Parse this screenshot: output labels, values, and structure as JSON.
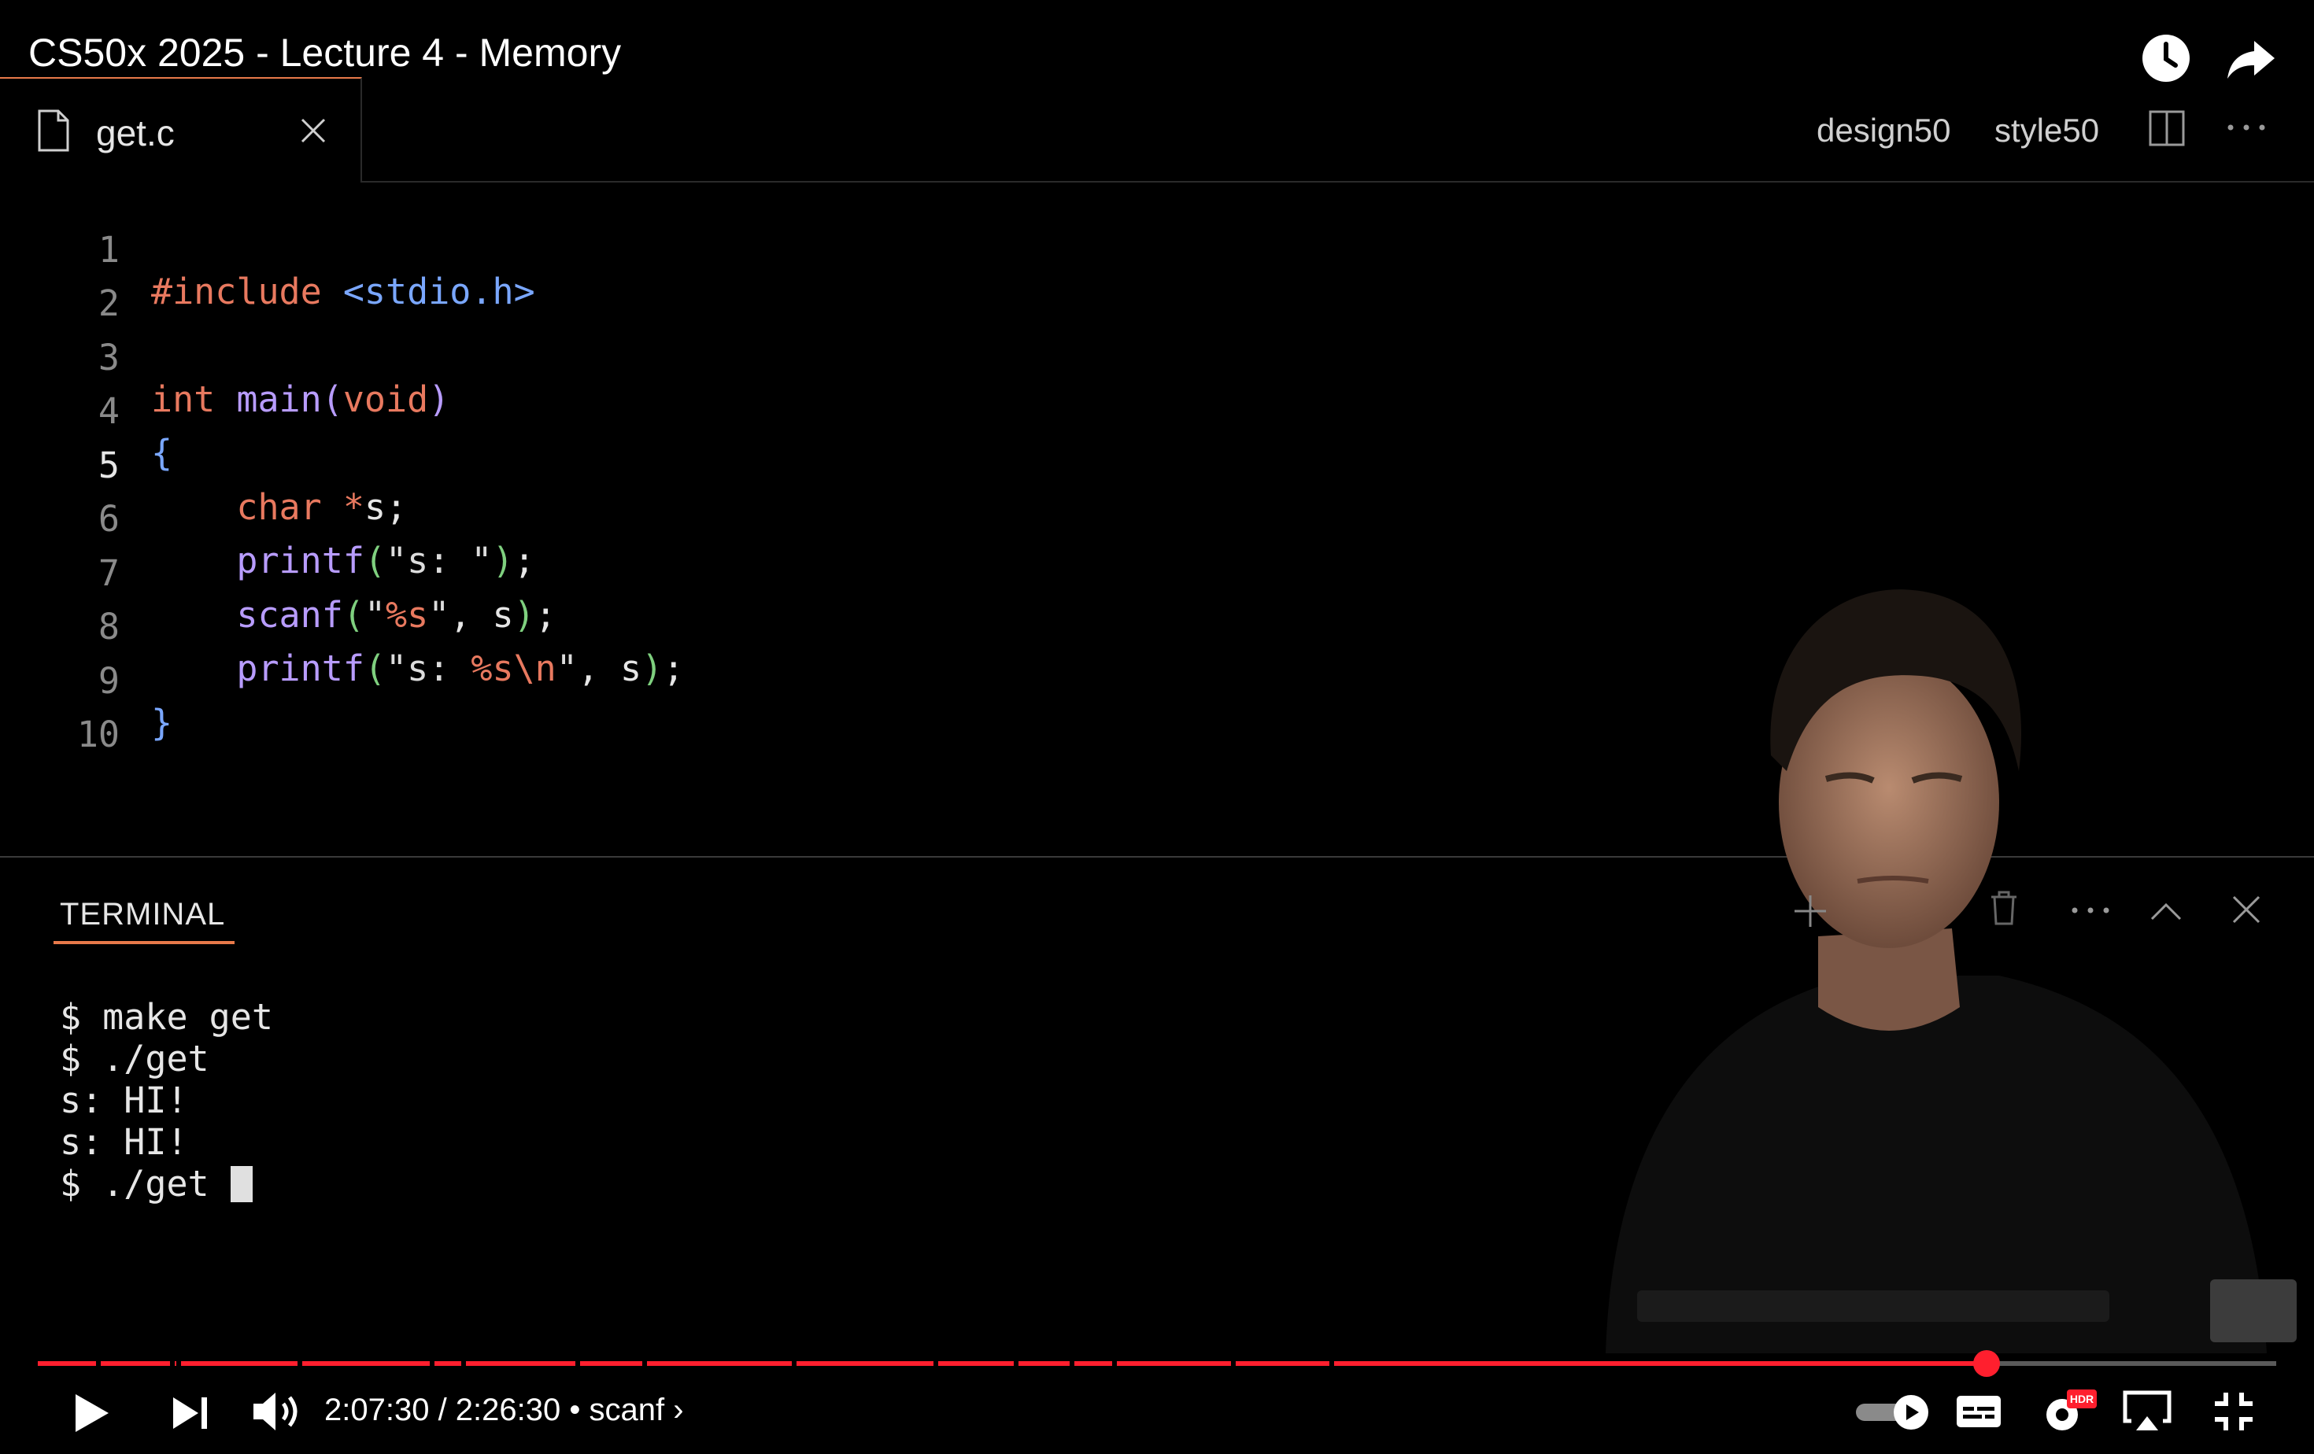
{
  "video": {
    "title": "CS50x 2025 - Lecture 4 - Memory"
  },
  "editor": {
    "tab": {
      "filename": "get.c"
    },
    "toolbar": {
      "design50": "design50",
      "style50": "style50"
    },
    "active_line": 5,
    "lines": [
      {
        "n": "1"
      },
      {
        "n": "2"
      },
      {
        "n": "3"
      },
      {
        "n": "4"
      },
      {
        "n": "5"
      },
      {
        "n": "6"
      },
      {
        "n": "7"
      },
      {
        "n": "8"
      },
      {
        "n": "9"
      },
      {
        "n": "10"
      }
    ],
    "code": {
      "l1_directive": "#include",
      "l1_header": "<stdio.h>",
      "l3_type": "int",
      "l3_name": "main",
      "l3_paren_open": "(",
      "l3_void": "void",
      "l3_paren_close": ")",
      "l4_brace": "{",
      "l5_type": "char",
      "l5_star": "*",
      "l5_rest": "s;",
      "l6_fn": "printf",
      "l6_open": "(",
      "l6_str": "\"s: \"",
      "l6_close": ")",
      "l6_semi": ";",
      "l7_fn": "scanf",
      "l7_open": "(",
      "l7_q1": "\"",
      "l7_fmt": "%s",
      "l7_q2": "\"",
      "l7_args": ", s",
      "l7_close": ")",
      "l7_semi": ";",
      "l8_fn": "printf",
      "l8_open": "(",
      "l8_q1": "\"s: ",
      "l8_fmt": "%s\\n",
      "l8_q2": "\"",
      "l8_args": ", s",
      "l8_close": ")",
      "l8_semi": ";",
      "l9_brace": "}"
    }
  },
  "terminal": {
    "tab_label": "TERMINAL",
    "lines": [
      "$ make get",
      "$ ./get",
      "s: HI!",
      "s: HI!",
      "$ ./get "
    ]
  },
  "player": {
    "time": "2:07:30 / 2:26:30",
    "chapter": "• scanf ›",
    "progress_fraction": 0.8706,
    "settings_badge": "HDR",
    "chapter_marks": [
      0.026,
      0.059,
      0.062,
      0.116,
      0.175,
      0.189,
      0.24,
      0.24,
      0.27,
      0.337,
      0.4,
      0.436,
      0.461,
      0.48,
      0.533,
      0.577
    ]
  },
  "colors": {
    "progress": "#ff1f2e",
    "accent_tab": "#e8794a"
  },
  "icons": [
    "clock-icon",
    "share-icon",
    "file-icon",
    "close-icon",
    "split-editor-icon",
    "more-icon",
    "plus-icon",
    "trash-icon",
    "chevron-up-icon",
    "play-icon",
    "next-icon",
    "volume-icon",
    "autoplay-icon",
    "subtitles-icon",
    "settings-icon",
    "airplay-icon",
    "exit-fullscreen-icon"
  ]
}
